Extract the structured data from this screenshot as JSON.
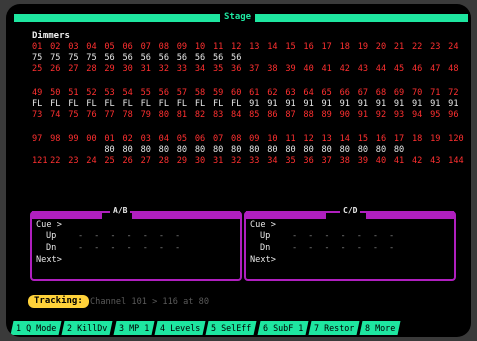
{
  "window_title": "Stage",
  "section_label": "Dimmers",
  "rows": [
    {
      "color": "red",
      "cells": [
        "01",
        "02",
        "03",
        "04",
        "05",
        "06",
        "07",
        "08",
        "09",
        "10",
        "11",
        "12",
        "13",
        "14",
        "15",
        "16",
        "17",
        "18",
        "19",
        "20",
        "21",
        "22",
        "23",
        "24"
      ]
    },
    {
      "color": "white",
      "cells": [
        "75",
        "75",
        "75",
        "75",
        "56",
        "56",
        "56",
        "56",
        "56",
        "56",
        "56",
        "56",
        "",
        "",
        "",
        "",
        "",
        "",
        "",
        "",
        "",
        "",
        "",
        ""
      ]
    },
    {
      "color": "red",
      "cells": [
        "25",
        "26",
        "27",
        "28",
        "29",
        "30",
        "31",
        "32",
        "33",
        "34",
        "35",
        "36",
        "37",
        "38",
        "39",
        "40",
        "41",
        "42",
        "43",
        "44",
        "45",
        "46",
        "47",
        "48"
      ]
    },
    {
      "color": "red",
      "cells": [
        "49",
        "50",
        "51",
        "52",
        "53",
        "54",
        "55",
        "56",
        "57",
        "58",
        "59",
        "60",
        "61",
        "62",
        "63",
        "64",
        "65",
        "66",
        "67",
        "68",
        "69",
        "70",
        "71",
        "72"
      ]
    },
    {
      "color": "white",
      "cells": [
        "FL",
        "FL",
        "FL",
        "FL",
        "FL",
        "FL",
        "FL",
        "FL",
        "FL",
        "FL",
        "FL",
        "FL",
        "91",
        "91",
        "91",
        "91",
        "91",
        "91",
        "91",
        "91",
        "91",
        "91",
        "91",
        "91"
      ]
    },
    {
      "color": "red",
      "cells": [
        "73",
        "74",
        "75",
        "76",
        "77",
        "78",
        "79",
        "80",
        "81",
        "82",
        "83",
        "84",
        "85",
        "86",
        "87",
        "88",
        "89",
        "90",
        "91",
        "92",
        "93",
        "94",
        "95",
        "96"
      ]
    },
    {
      "color": "red",
      "cells": [
        "97",
        "98",
        "99",
        "00",
        "01",
        "02",
        "03",
        "04",
        "05",
        "06",
        "07",
        "08",
        "09",
        "10",
        "11",
        "12",
        "13",
        "14",
        "15",
        "16",
        "17",
        "18",
        "19",
        "120"
      ]
    },
    {
      "color": "white",
      "cells": [
        "",
        "",
        "",
        "",
        "80",
        "80",
        "80",
        "80",
        "80",
        "80",
        "80",
        "80",
        "80",
        "80",
        "80",
        "80",
        "80",
        "80",
        "80",
        "80",
        "80",
        "",
        "",
        ""
      ]
    },
    {
      "color": "red",
      "cells": [
        "121",
        "22",
        "23",
        "24",
        "25",
        "26",
        "27",
        "28",
        "29",
        "30",
        "31",
        "32",
        "33",
        "34",
        "35",
        "36",
        "37",
        "38",
        "39",
        "40",
        "41",
        "42",
        "43",
        "144"
      ]
    }
  ],
  "panels": [
    {
      "title": "A/B",
      "cue_label": "Cue >",
      "up_label": "Up",
      "dn_label": "Dn",
      "next_label": "Next>"
    },
    {
      "title": "C/D",
      "cue_label": "Cue >",
      "up_label": "Up",
      "dn_label": "Dn",
      "next_label": "Next>"
    }
  ],
  "tracking": {
    "label": "Tracking:",
    "text": "Channel 101 > 116 at 80"
  },
  "softkeys": [
    "1 Q Mode",
    "2 KillDv",
    "3 MP 1",
    "4 Levels",
    "5 SelEff",
    "6 SubF 1",
    "7 Restor",
    "8 More"
  ],
  "colors": {
    "accent": "#1ee6a0",
    "channel_number": "#ff3030",
    "level": "#e8e8e8",
    "panel_border": "#b01fbf",
    "tracking_badge": "#ffd23a"
  }
}
